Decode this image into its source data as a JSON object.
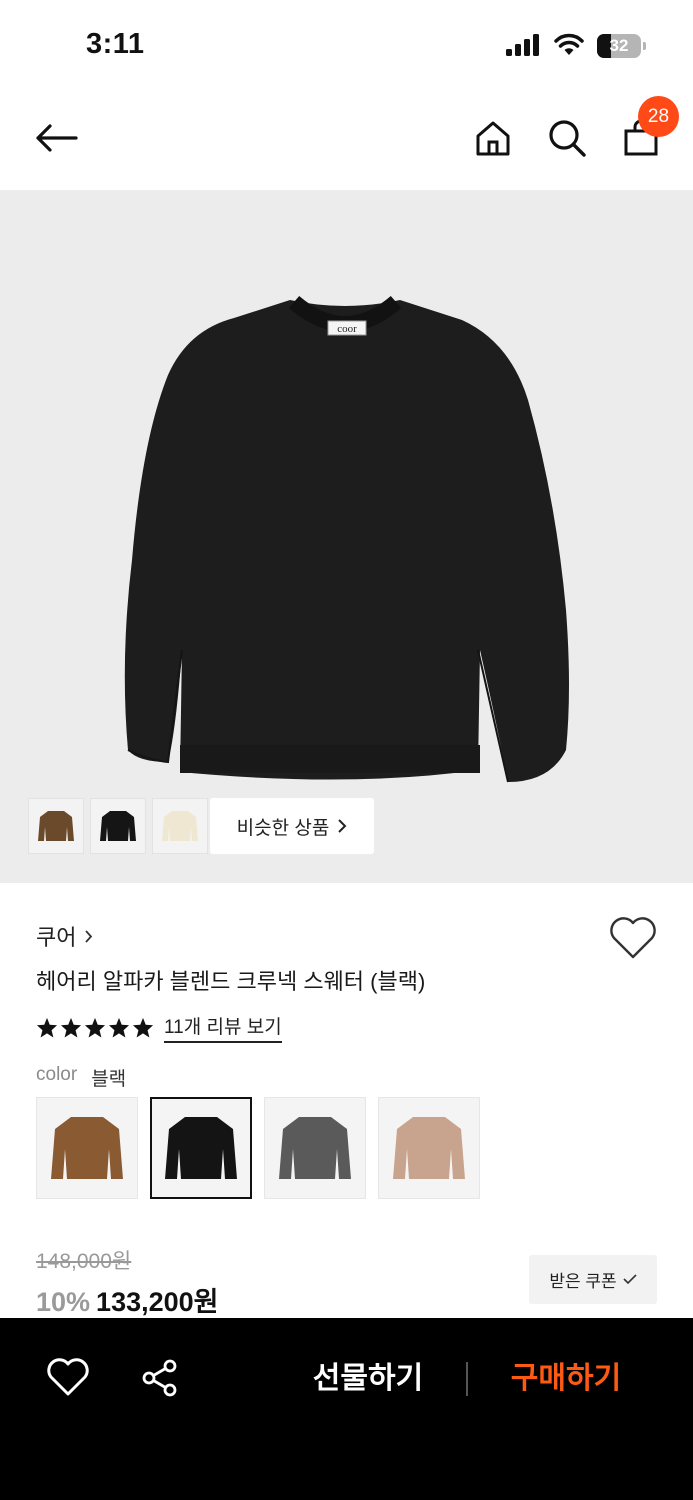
{
  "status_bar": {
    "time": "3:11",
    "battery_level": "32",
    "battery_fraction": 0.32
  },
  "nav": {
    "icons": [
      "arrow-left-icon",
      "home-icon",
      "search-icon",
      "shopping-bag-icon"
    ],
    "cart_count": "28",
    "badge_color": "#ff4a17"
  },
  "hero": {
    "brand_tag": "coor",
    "thumbnail_colors": [
      "#6b4a2b",
      "#151515",
      "#efe7d2"
    ],
    "similar_label": "비슷한 상품"
  },
  "product": {
    "brand": "쿠어",
    "name": "헤어리 알파카 블렌드 크루넥 스웨터 (블랙)",
    "rating_stars": 5,
    "review_link": "11개 리뷰 보기",
    "color_label": "color",
    "color_value": "블랙",
    "swatch_colors": [
      "#8a5a33",
      "#141414",
      "#5a5a5a",
      "#c8a48e"
    ],
    "selected_swatch": 1
  },
  "price": {
    "original": "148,000원",
    "discount": "10%",
    "sale": "133,200원",
    "coupon_label": "받은 쿠폰"
  },
  "bottom_bar": {
    "gift_label": "선물하기",
    "buy_label": "구매하기",
    "accent": "#ff5a14"
  }
}
